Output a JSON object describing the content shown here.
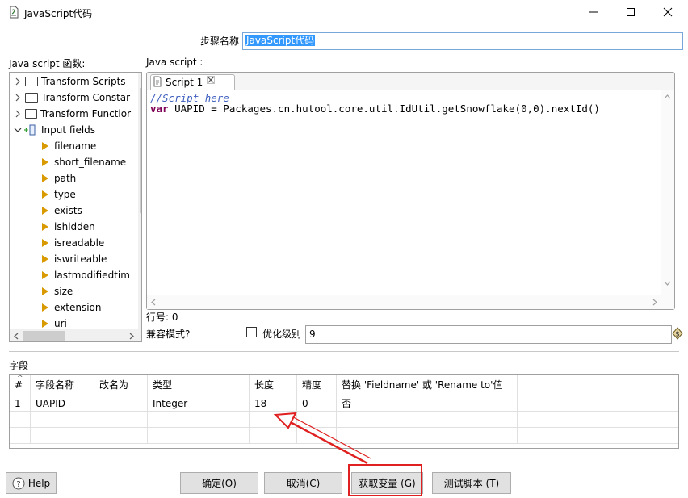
{
  "window": {
    "title": "JavaScript代码"
  },
  "step": {
    "label": "步骤名称",
    "value": "JavaScript代码"
  },
  "functions_label": "Java script 函数:",
  "script_label": "Java script :",
  "tree": {
    "folders": [
      "Transform Scripts",
      "Transform Constar",
      "Transform Functior"
    ],
    "input_fields_label": "Input fields",
    "fields": [
      "filename",
      "short_filename",
      "path",
      "type",
      "exists",
      "ishidden",
      "isreadable",
      "iswriteable",
      "lastmodifiedtim",
      "size",
      "extension",
      "uri"
    ]
  },
  "editor": {
    "tab_label": "Script 1",
    "line1": "//Script here",
    "line2_keyword": "var",
    "line2_rest": " UAPID = Packages.cn.hutool.core.util.IdUtil.getSnowflake(0,0).nextId()"
  },
  "status": {
    "line_number": "行号: 0",
    "compat_label": "兼容模式?",
    "optimize_label": "优化级别",
    "optimize_value": "9"
  },
  "fields_section": {
    "label": "字段",
    "headers": [
      "#",
      "字段名称",
      "改名为",
      "类型",
      "长度",
      "精度",
      "替换 'Fieldname' 或 'Rename to'值"
    ],
    "rows": [
      [
        "1",
        "UAPID",
        "",
        "Integer",
        "18",
        "0",
        "否"
      ]
    ]
  },
  "buttons": {
    "help": "Help",
    "ok": "确定(O)",
    "cancel": "取消(C)",
    "get_vars": "获取变量 (G)",
    "test": "测试脚本 (T)"
  },
  "colors": {
    "highlight": "#e02020",
    "selection": "#3399ff",
    "leaf_arrow": "#d99a00"
  }
}
